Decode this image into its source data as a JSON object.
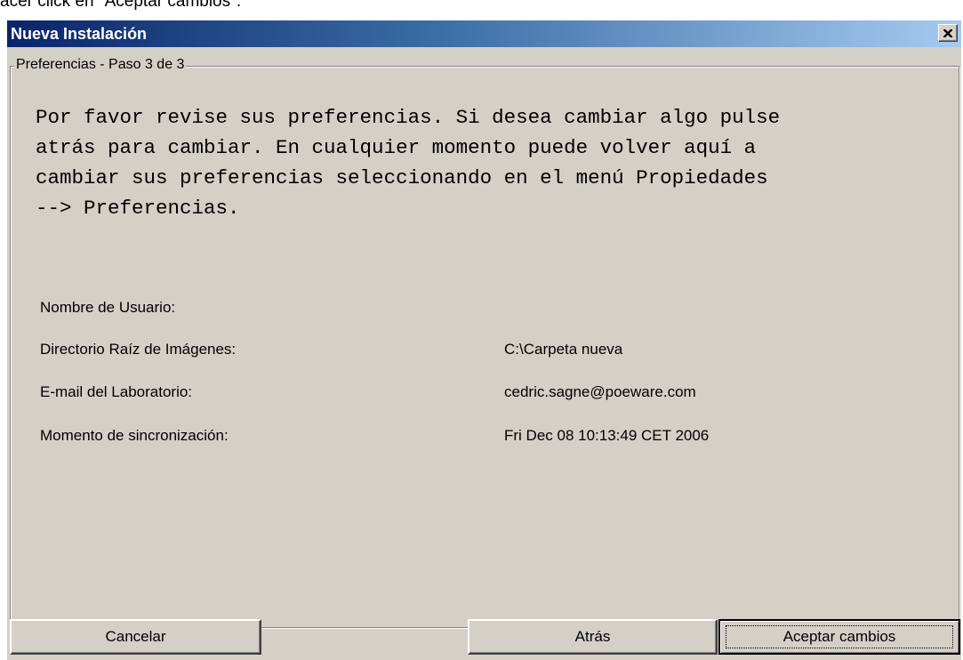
{
  "caption": "acer click en \"Aceptar cambios\".",
  "window": {
    "title": "Nueva Instalación",
    "close_icon": "close-icon"
  },
  "group": {
    "legend": "Preferencias - Paso 3 de 3",
    "intro_lines": [
      "Por favor revise sus preferencias. Si desea cambiar algo pulse",
      "atrás para cambiar. En cualquier momento puede volver aquí a",
      "cambiar sus preferencias seleccionando en el menú Propiedades",
      "--> Preferencias."
    ],
    "fields": [
      {
        "label": "Nombre de Usuario:",
        "value": ""
      },
      {
        "label": "Directorio Raíz de Imágenes:",
        "value": "C:\\Carpeta nueva"
      },
      {
        "label": "E-mail del Laboratorio:",
        "value": "cedric.sagne@poeware.com"
      },
      {
        "label": "Momento de sincronización:",
        "value": "Fri Dec 08 10:13:49 CET 2006"
      }
    ]
  },
  "buttons": {
    "cancel": "Cancelar",
    "back": "Atrás",
    "accept": "Aceptar cambios"
  },
  "colors": {
    "titlebar_start": "#0a246a",
    "titlebar_end": "#a6caf0",
    "face": "#d4d0c8"
  }
}
